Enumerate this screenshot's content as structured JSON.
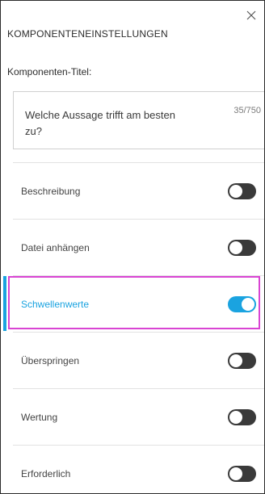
{
  "panel": {
    "title": "KOMPONENTENEINSTELLUNGEN",
    "close_icon": "close-icon"
  },
  "title_field": {
    "label": "Komponenten-Titel:",
    "value": "Welche Aussage trifft am besten zu?",
    "counter": "35/750"
  },
  "settings": [
    {
      "label": "Beschreibung",
      "enabled": false
    },
    {
      "label": "Datei anhängen",
      "enabled": false
    },
    {
      "label": "Schwellenwerte",
      "enabled": true,
      "active": true
    },
    {
      "label": "Überspringen",
      "enabled": false
    },
    {
      "label": "Wertung",
      "enabled": false
    },
    {
      "label": "Erforderlich",
      "enabled": false
    }
  ],
  "colors": {
    "accent": "#1aa3e0",
    "toggle_off": "#3a3a3a",
    "highlight": "#d944d3"
  }
}
